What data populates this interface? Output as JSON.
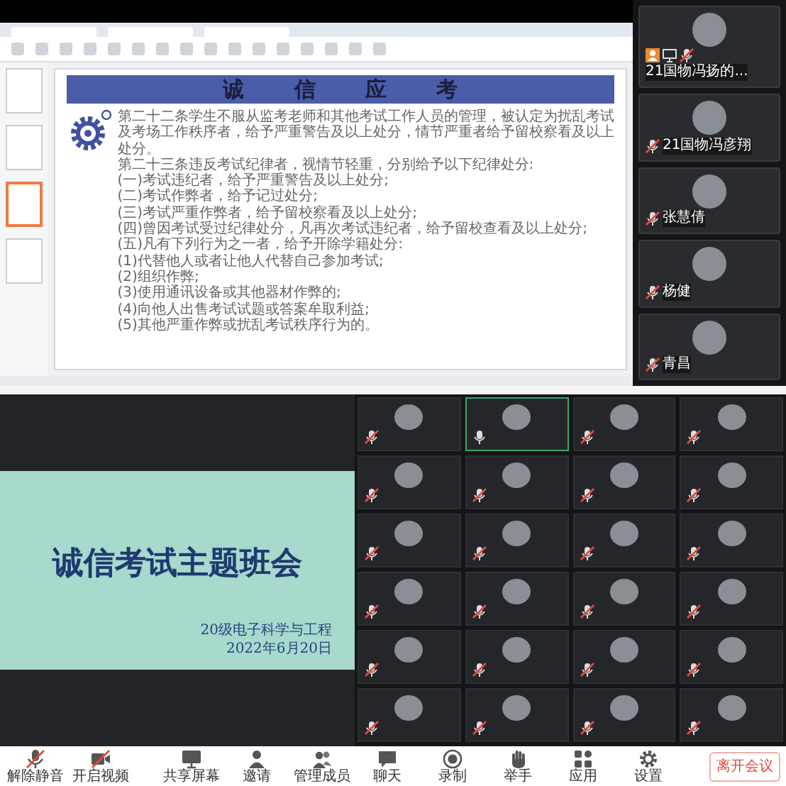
{
  "presentation": {
    "thumbnails": [
      {
        "selected": false
      },
      {
        "selected": false
      },
      {
        "selected": true
      },
      {
        "selected": false
      }
    ],
    "slide": {
      "heading": "诚 信 应 考",
      "paragraphs": [
        "第二十二条学生不服从监考老师和其他考试工作人员的管理，被认定为扰乱考试及考场工作秩序者，给予严重警告及以上处分，情节严重者给予留校察看及以上处分。",
        "第二十三条违反考试纪律者，视情节轻重，分别给予以下纪律处分:",
        "(一)考试违纪者，给予严重警告及以上处分;",
        "(二)考试作弊者，给予记过处分;",
        "(三)考试严重作弊者，给予留校察看及以上处分;",
        "(四)曾因考试受过纪律处分，凡再次考试违纪者，给予留校查看及以上处分;",
        "(五)凡有下列行为之一者，给予开除学籍处分:",
        "(1)代替他人或者让他人代替自己参加考试;",
        "(2)组织作弊;",
        "(3)使用通讯设备或其他器材作弊的;",
        "(4)向他人出售考试试题或答案牟取利益;",
        "(5)其他严重作弊或扰乱考试秩序行为的。"
      ]
    }
  },
  "side_participants": [
    {
      "name": "21国物冯扬的...",
      "host": true,
      "sharing": true,
      "muted": true
    },
    {
      "name": "21国物冯彦翔",
      "host": false,
      "sharing": false,
      "muted": true
    },
    {
      "name": "张慧倩",
      "host": false,
      "sharing": false,
      "muted": true
    },
    {
      "name": "杨健",
      "host": false,
      "sharing": false,
      "muted": true
    },
    {
      "name": "青昌",
      "host": false,
      "sharing": false,
      "muted": true
    }
  ],
  "shared_slide": {
    "title": "诚信考试主题班会",
    "class_name": "20级电子科学与工程",
    "date": "2022年6月20日"
  },
  "participant_grid": [
    {
      "speaking": false,
      "muted": true
    },
    {
      "speaking": true,
      "muted": false
    },
    {
      "speaking": false,
      "muted": true
    },
    {
      "speaking": false,
      "muted": true
    },
    {
      "speaking": false,
      "muted": true
    },
    {
      "speaking": false,
      "muted": true
    },
    {
      "speaking": false,
      "muted": true
    },
    {
      "speaking": false,
      "muted": true
    },
    {
      "speaking": false,
      "muted": true
    },
    {
      "speaking": false,
      "muted": true
    },
    {
      "speaking": false,
      "muted": true
    },
    {
      "speaking": false,
      "muted": true
    },
    {
      "speaking": false,
      "muted": true
    },
    {
      "speaking": false,
      "muted": true
    },
    {
      "speaking": false,
      "muted": true
    },
    {
      "speaking": false,
      "muted": true
    },
    {
      "speaking": false,
      "muted": true
    },
    {
      "speaking": false,
      "muted": true
    },
    {
      "speaking": false,
      "muted": true
    },
    {
      "speaking": false,
      "muted": true
    },
    {
      "speaking": false,
      "muted": true
    },
    {
      "speaking": false,
      "muted": true
    },
    {
      "speaking": false,
      "muted": true
    },
    {
      "speaking": false,
      "muted": true
    }
  ],
  "toolbar": {
    "buttons": [
      {
        "kind": "mic",
        "label": "解除静音"
      },
      {
        "kind": "camera",
        "label": "开启视频"
      },
      {
        "kind": "screen",
        "label": "共享屏幕"
      },
      {
        "kind": "person",
        "label": "邀请"
      },
      {
        "kind": "people",
        "label": "管理成员"
      },
      {
        "kind": "chat",
        "label": "聊天"
      },
      {
        "kind": "record",
        "label": "录制"
      },
      {
        "kind": "hand",
        "label": "举手"
      },
      {
        "kind": "apps",
        "label": "应用"
      },
      {
        "kind": "gear",
        "label": "设置"
      }
    ],
    "leave": "离开会议"
  }
}
